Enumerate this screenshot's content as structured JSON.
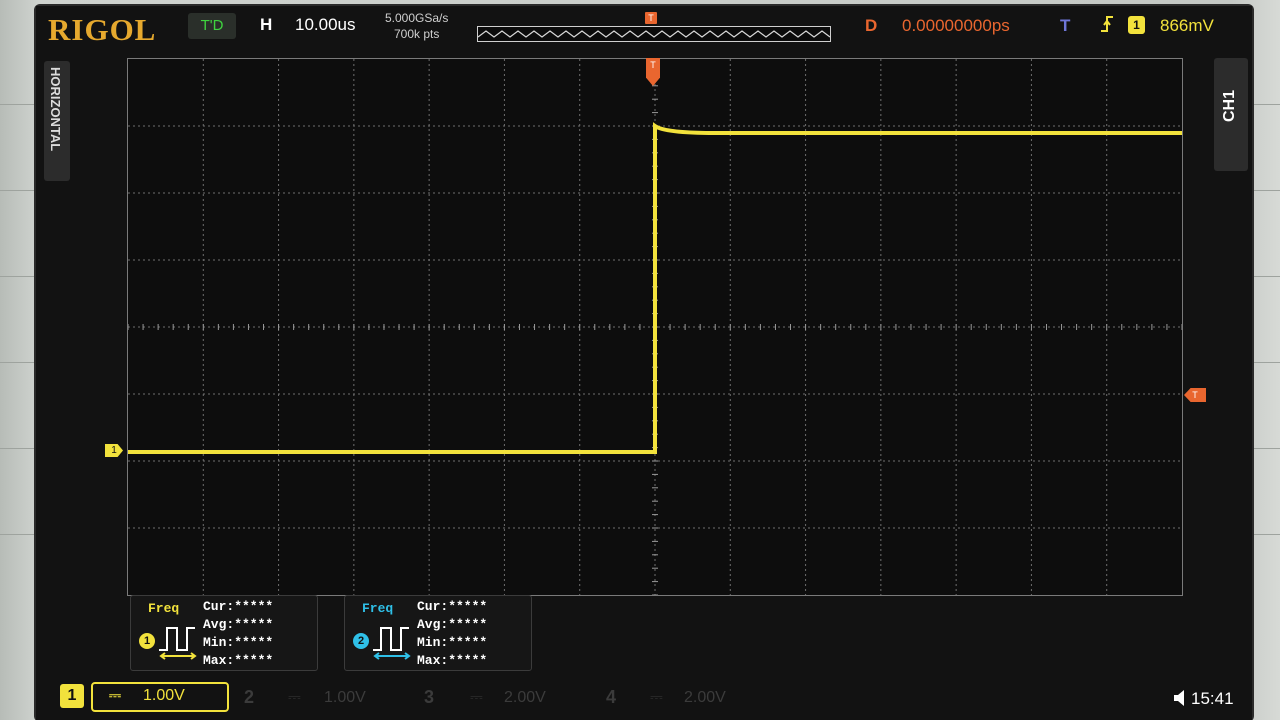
{
  "header": {
    "brand": "RIGOL",
    "run_mode": "T'D",
    "horizontal_label": "H",
    "timebase": "10.00us",
    "sample_rate": "5.000GSa/s",
    "memory_depth": "700k pts",
    "memory_trigger_marker": "T",
    "delay_label": "D",
    "delay_value": "0.00000000ps",
    "trigger_label": "T",
    "trigger_source": "1",
    "trigger_level": "866mV"
  },
  "side": {
    "left_tab": "HORIZONTAL",
    "right_tab": "CH1"
  },
  "markers": {
    "channel_marker": "1",
    "trigger_position_marker": "T",
    "trigger_level_marker": "T"
  },
  "colors": {
    "ch1": "#f2e23c",
    "ch2": "#2fc0e8",
    "trigger": "#e9662f",
    "run_mode": "#3fd23f",
    "grid": "#6e6e6e"
  },
  "measurements": [
    {
      "channel": "1",
      "title": "Freq",
      "cur": "Cur:*****",
      "avg": "Avg:*****",
      "min": "Min:*****",
      "max": "Max:*****"
    },
    {
      "channel": "2",
      "title": "Freq",
      "cur": "Cur:*****",
      "avg": "Avg:*****",
      "min": "Min:*****",
      "max": "Max:*****"
    }
  ],
  "bottom": {
    "ch1": {
      "number": "1",
      "coupling": "⎓",
      "scale": "1.00V"
    },
    "ch2": {
      "number": "2",
      "coupling": "⎓",
      "scale": "1.00V"
    },
    "ch3": {
      "number": "3",
      "coupling": "⎓",
      "scale": "2.00V"
    },
    "ch4": {
      "number": "4",
      "coupling": "⎓",
      "scale": "2.00V"
    },
    "clock": "15:41"
  }
}
